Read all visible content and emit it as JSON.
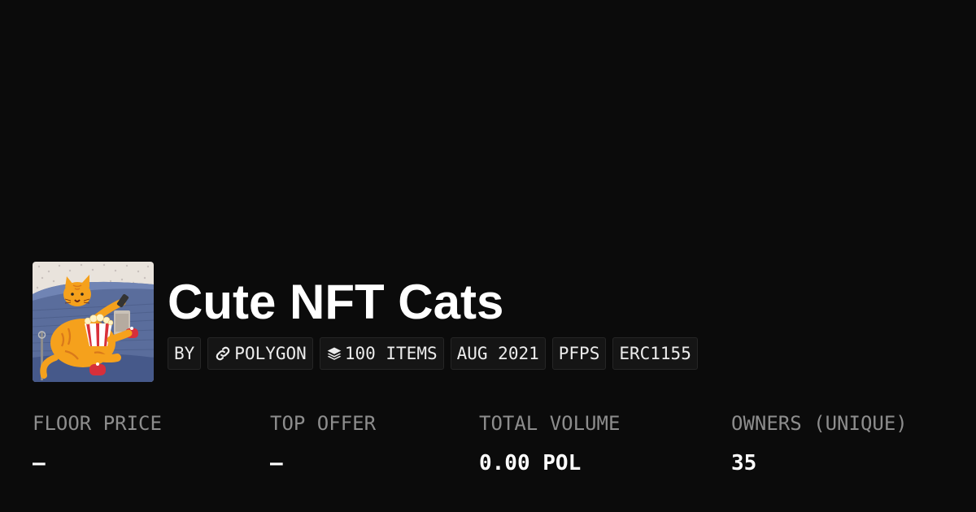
{
  "collection": {
    "title": "Cute NFT Cats",
    "avatar_icon": "cat-with-popcorn-artwork"
  },
  "tags": {
    "by": "BY",
    "chain": "POLYGON",
    "chain_icon": "link-icon",
    "items": "100 ITEMS",
    "items_icon": "layers-icon",
    "date": "AUG 2021",
    "category": "PFPS",
    "standard": "ERC1155"
  },
  "stats": {
    "floor_price": {
      "label": "FLOOR PRICE",
      "value": "—"
    },
    "top_offer": {
      "label": "TOP OFFER",
      "value": "—"
    },
    "total_volume": {
      "label": "TOTAL VOLUME",
      "value": "0.00 POL"
    },
    "owners": {
      "label": "OWNERS (UNIQUE)",
      "value": "35"
    }
  },
  "colors": {
    "background": "#0b0b0b",
    "tag_background": "#151515",
    "label_gray": "#8d8d8d",
    "cat_orange": "#f5a11c"
  }
}
